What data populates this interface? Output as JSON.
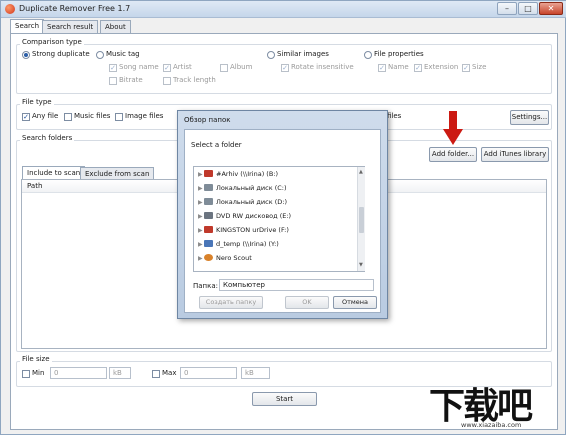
{
  "window": {
    "title": "Duplicate Remover Free 1.7",
    "minimize_glyph": "–",
    "maximize_glyph": "□",
    "close_glyph": "✕"
  },
  "tabs": [
    "Search",
    "Search result",
    "About"
  ],
  "comparison": {
    "legend": "Comparison type",
    "strong_duplicate": "Strong duplicate",
    "music_tag": "Music tag",
    "song_name": "Song name",
    "artist": "Artist",
    "album": "Album",
    "bitrate": "Bitrate",
    "track_length": "Track length",
    "similar_images": "Similar images",
    "rotate_insensitive": "Rotate insensitive",
    "file_properties": "File properties",
    "name": "Name",
    "extension": "Extension",
    "size": "Size"
  },
  "file_type": {
    "legend": "File type",
    "any_file": "Any file",
    "music_files": "Music files",
    "image_files": "Image files",
    "files_suffix": "files",
    "settings_button": "Settings..."
  },
  "search_folders": {
    "legend": "Search folders",
    "add_folder_button": "Add folder...",
    "add_itunes_button": "Add iTunes library",
    "tab_include": "Include to scan",
    "tab_exclude": "Exclude from scan",
    "column_path": "Path"
  },
  "file_size": {
    "legend": "File size",
    "min_label": "Min",
    "min_value": "0",
    "min_unit": "kB",
    "max_label": "Max",
    "max_value": "0",
    "max_unit": "kB"
  },
  "start_button": "Start",
  "dialog": {
    "title": "Обзор папок",
    "prompt": "Select a folder",
    "tree_items": [
      {
        "label": "#Arhiv (\\\\Irina) (B:)",
        "icon": "network-drive-icon",
        "color": "#c0392b"
      },
      {
        "label": "Локальный диск (C:)",
        "icon": "local-disk-icon",
        "color": "#7f8c98"
      },
      {
        "label": "Локальный диск (D:)",
        "icon": "local-disk-icon",
        "color": "#7f8c98"
      },
      {
        "label": "DVD RW дисковод (E:)",
        "icon": "dvd-drive-icon",
        "color": "#6b7480"
      },
      {
        "label": "KINGSTON urDrive (F:)",
        "icon": "usb-drive-icon",
        "color": "#c0392b"
      },
      {
        "label": "d_temp (\\\\Irina) (Y:)",
        "icon": "network-drive-icon",
        "color": "#4a76b8"
      },
      {
        "label": "Nero Scout",
        "icon": "nero-icon",
        "color": "#d9822b"
      }
    ],
    "folder_label": "Папка:",
    "folder_value": "Компьютер",
    "create_folder_button": "Создать папку",
    "ok_button": "OK",
    "cancel_button": "Отмена"
  },
  "watermark": {
    "brand": "下载吧",
    "url": "www.xiazaiba.com"
  },
  "colors": {
    "arrow": "#cc1a12",
    "titlebar": "#c5d6ea",
    "dialog_frame": "#b9cbe1"
  }
}
